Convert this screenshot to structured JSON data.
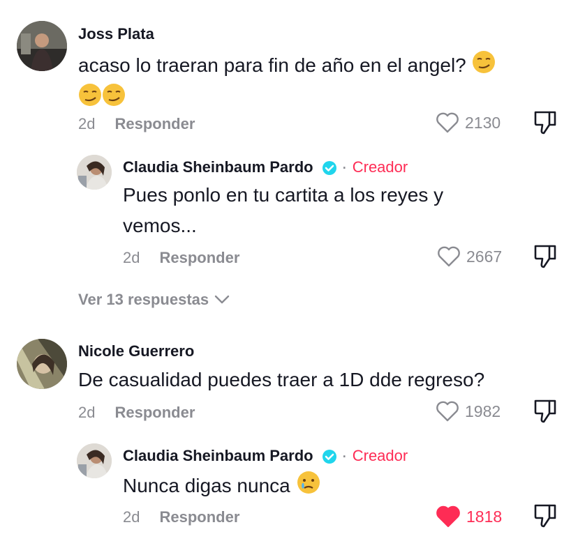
{
  "comments": [
    {
      "author": "Joss Plata",
      "text_line1": "acaso lo traeran para fin de año en el angel?",
      "time": "2d",
      "reply_label": "Responder",
      "likes": "2130",
      "liked": false,
      "reply": {
        "author": "Claudia Sheinbaum Pardo",
        "badge": "Creador",
        "text_line1": "Pues ponlo en tu cartita a los reyes y",
        "text_line2": "vemos...",
        "time": "2d",
        "reply_label": "Responder",
        "likes": "2667",
        "liked": false
      },
      "more_replies": "Ver 13 respuestas"
    },
    {
      "author": "Nicole Guerrero",
      "text_line1": "De casualidad puedes traer a 1D dde regreso?",
      "time": "2d",
      "reply_label": "Responder",
      "likes": "1982",
      "liked": false,
      "reply": {
        "author": "Claudia Sheinbaum Pardo",
        "badge": "Creador",
        "text_line1": "Nunca digas nunca",
        "time": "2d",
        "reply_label": "Responder",
        "likes": "1818",
        "liked": true
      }
    }
  ],
  "icons": {
    "like": "heart-icon",
    "dislike": "thumbs-down-icon",
    "verified": "verified-check-icon",
    "chevron": "chevron-down-icon",
    "emoji_smirk": "smirking-face-emoji",
    "emoji_tear": "tear-face-emoji"
  },
  "colors": {
    "accent": "#fe2c55",
    "verified": "#20d5ec",
    "secondary_text": "#8a8b91",
    "primary_text": "#161823"
  }
}
